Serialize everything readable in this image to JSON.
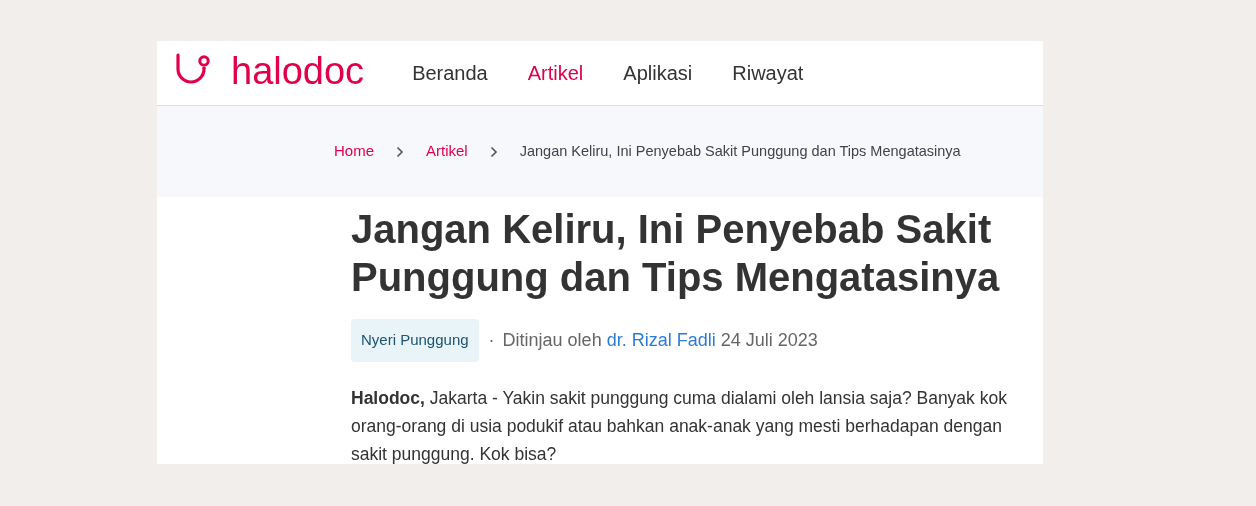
{
  "header": {
    "logo": "halodoc",
    "nav": [
      {
        "label": "Beranda",
        "selected": false
      },
      {
        "label": "Artikel",
        "selected": true
      },
      {
        "label": "Aplikasi",
        "selected": false
      },
      {
        "label": "Riwayat",
        "selected": false
      }
    ]
  },
  "breadcrumb": [
    {
      "label": "Home",
      "kind": "link"
    },
    {
      "label": "Artikel",
      "kind": "link"
    },
    {
      "label": "Jangan Keliru, Ini Penyebab Sakit Punggung dan Tips Mengatasinya",
      "kind": "current"
    }
  ],
  "article": {
    "title": "Jangan Keliru, Ini Penyebab Sakit Punggung dan Tips Mengatasinya",
    "tag": "Nyeri Punggung",
    "separator": "·",
    "reviewed_by": "Ditinjau oleh",
    "reviewer": "dr. Rizal Fadli",
    "date": "24 Juli 2023",
    "body": "**Halodoc,** Jakarta - Yakin sakit punggung cuma dialami oleh lansia saja? Banyak kok orang-orang di usia podukif atau bahkan anak-anak yang mesti berhadapan dengan sakit punggung. Kok bisa?"
  }
}
